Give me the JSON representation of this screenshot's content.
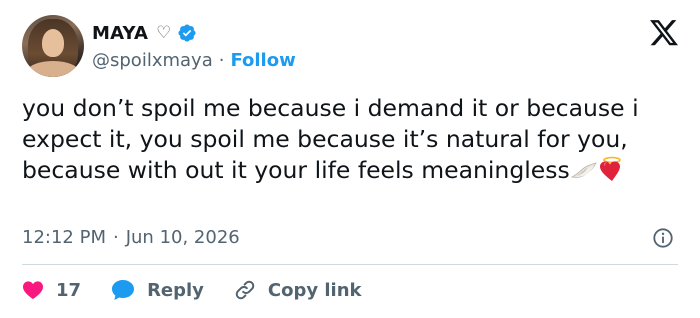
{
  "author": {
    "name": "MAYA",
    "name_symbol": "♡",
    "handle": "@spoilxmaya",
    "separator": "·",
    "follow_label": "Follow"
  },
  "tweet": {
    "text": "you don’t spoil me because i demand it or because i expect it, you spoil me because it’s natural for you, because with out it your life feels meaningless",
    "emojis": [
      "wing-icon",
      "heart-with-halo-icon"
    ]
  },
  "meta": {
    "time": "12:12 PM",
    "separator": "·",
    "date": "Jun 10, 2026"
  },
  "actions": {
    "like_count": "17",
    "reply_label": "Reply",
    "copy_link_label": "Copy link"
  },
  "colors": {
    "accent": "#1d9bf0",
    "like": "#f91880",
    "text": "#0f1419",
    "muted": "#536471",
    "divider": "#cfd9de"
  }
}
